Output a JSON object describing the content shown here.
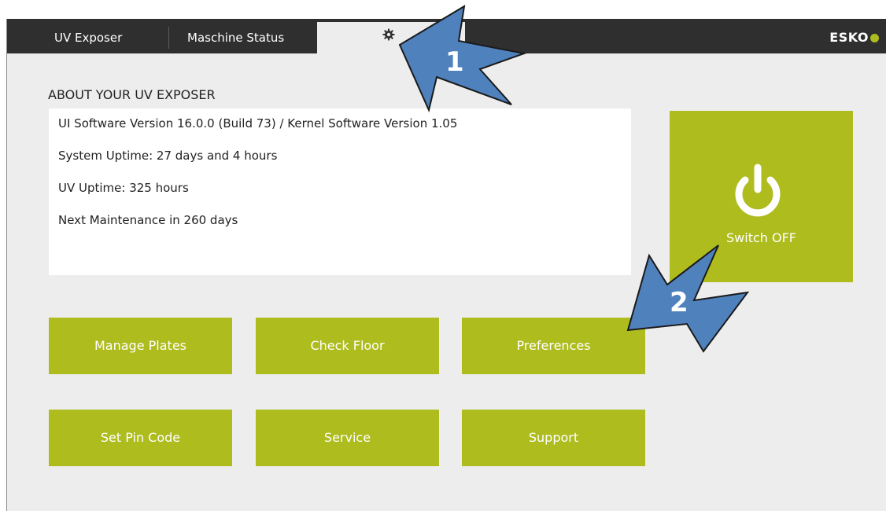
{
  "tabs": [
    {
      "label": "UV Exposer"
    },
    {
      "label": "Maschine Status"
    }
  ],
  "settings_tab": {
    "icon": "gear-icon"
  },
  "brand": {
    "name": "ESKO"
  },
  "about": {
    "title": "ABOUT YOUR UV EXPOSER",
    "lines": [
      "UI Software Version 16.0.0 (Build 73) / Kernel Software Version 1.05",
      "System Uptime: 27 days and 4 hours",
      "UV Uptime: 325 hours",
      "Next Maintenance in 260 days"
    ]
  },
  "power": {
    "label": "Switch OFF",
    "icon": "power-icon"
  },
  "actions": [
    {
      "label": "Manage Plates"
    },
    {
      "label": "Check Floor"
    },
    {
      "label": "Preferences"
    },
    {
      "label": "Set Pin Code"
    },
    {
      "label": "Service"
    },
    {
      "label": "Support"
    }
  ],
  "callouts": [
    {
      "number": "1"
    },
    {
      "number": "2"
    }
  ],
  "colors": {
    "accent": "#aebc1e",
    "topbar": "#2f2f2f",
    "background": "#ededed",
    "callout_arrow": "#4f81bd"
  }
}
